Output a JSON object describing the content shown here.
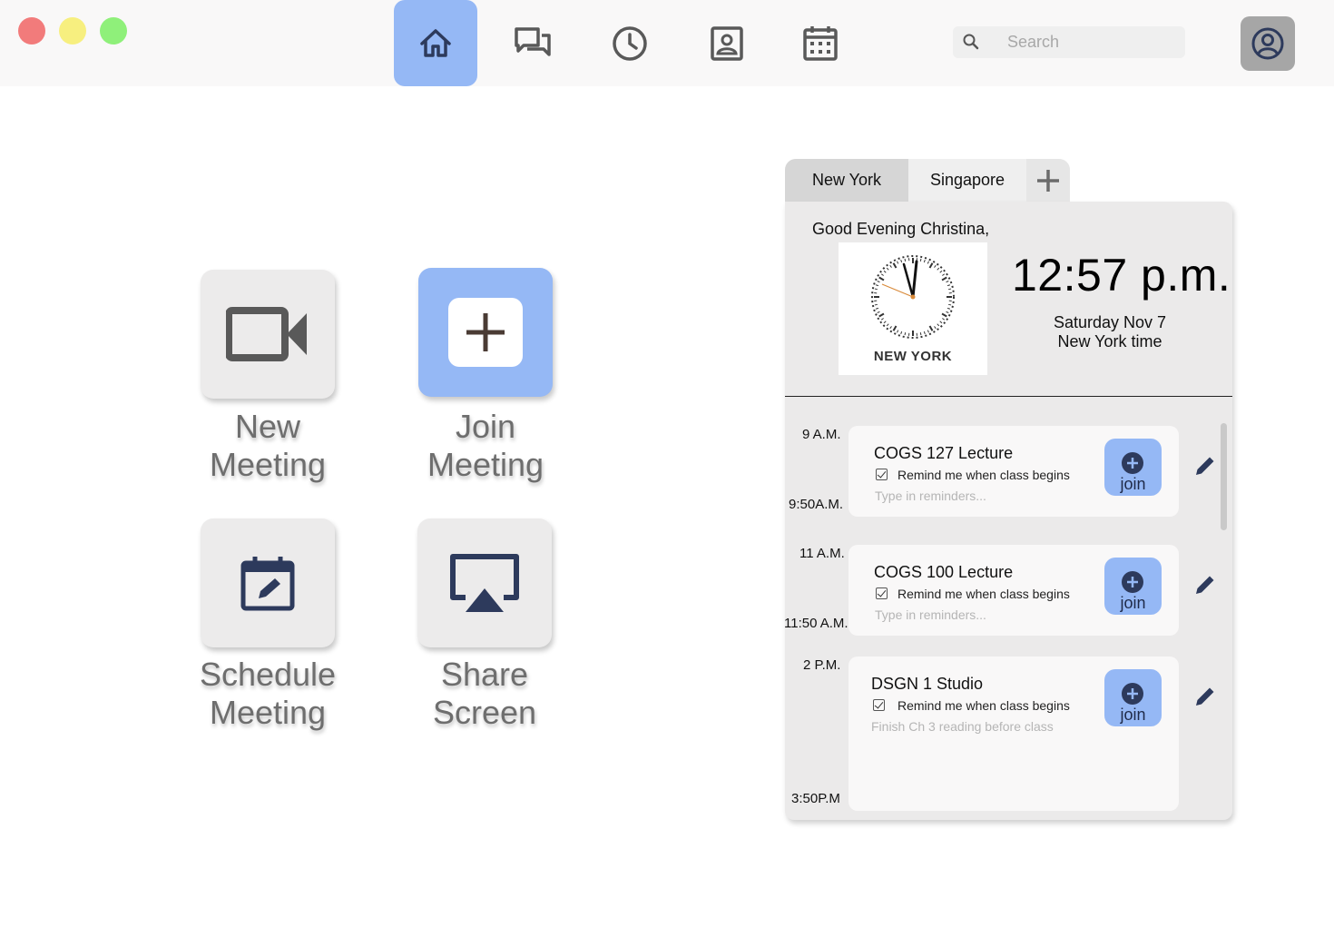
{
  "window": {
    "controls": [
      "close",
      "minimize",
      "zoom"
    ]
  },
  "nav": {
    "items": [
      {
        "name": "home",
        "icon": "home-icon",
        "active": true
      },
      {
        "name": "chat",
        "icon": "chat-icon",
        "active": false
      },
      {
        "name": "history",
        "icon": "clock-icon",
        "active": false
      },
      {
        "name": "contacts",
        "icon": "contact-card-icon",
        "active": false
      },
      {
        "name": "calendar",
        "icon": "calendar-icon",
        "active": false
      }
    ]
  },
  "search": {
    "placeholder": "Search",
    "value": ""
  },
  "profile": {
    "icon": "user-circle-icon"
  },
  "actions": {
    "new_meeting": {
      "line1": "New",
      "line2": "Meeting",
      "icon": "video-camera-icon"
    },
    "join_meeting": {
      "line1": "Join",
      "line2": "Meeting",
      "icon": "plus-icon"
    },
    "schedule_meeting": {
      "line1": "Schedule",
      "line2": "Meeting",
      "icon": "calendar-edit-icon"
    },
    "share_screen": {
      "line1": "Share",
      "line2": "Screen",
      "icon": "airplay-icon"
    }
  },
  "timezone_tabs": {
    "tabs": [
      {
        "label": "New York",
        "active": true
      },
      {
        "label": "Singapore",
        "active": false
      }
    ],
    "add_icon": "plus-icon"
  },
  "header": {
    "greeting": "Good Evening Christina,",
    "clock_city": "NEW YORK",
    "time": "12:57 p.m.",
    "date": "Saturday Nov 7",
    "zone": "New York time"
  },
  "schedule": {
    "join_label": "join",
    "events": [
      {
        "start": "9 A.M.",
        "end": "9:50A.M.",
        "title": "COGS 127 Lecture",
        "remind": "Remind me when class begins",
        "remind_checked": true,
        "note": "Type in reminders..."
      },
      {
        "start": "11 A.M.",
        "end": "11:50 A.M.",
        "title": "COGS 100 Lecture",
        "remind": "Remind me when class begins",
        "remind_checked": true,
        "note": "Type in reminders..."
      },
      {
        "start": "2 P.M.",
        "end": "3:50P.M",
        "title": "DSGN 1 Studio",
        "remind": "Remind me when class begins",
        "remind_checked": true,
        "note": "Finish Ch 3 reading before class"
      }
    ]
  },
  "colors": {
    "accent_blue": "#95b8f5",
    "icon_navy": "#2d3a5c",
    "icon_gray": "#595959"
  }
}
